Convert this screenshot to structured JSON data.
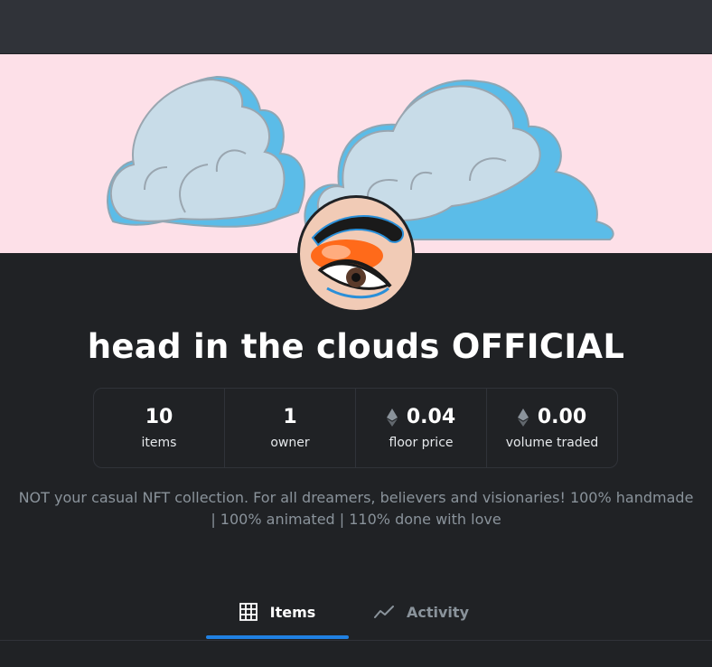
{
  "collection": {
    "title": "head in the clouds OFFICIAL",
    "description": "NOT your casual NFT collection. For all dreamers, believers and visionaries! 100% handmade | 100% animated | 110% done with love"
  },
  "stats": [
    {
      "value": "10",
      "label": "items",
      "eth": false
    },
    {
      "value": "1",
      "label": "owner",
      "eth": false
    },
    {
      "value": "0.04",
      "label": "floor price",
      "eth": true
    },
    {
      "value": "0.00",
      "label": "volume traded",
      "eth": true
    }
  ],
  "tabs": [
    {
      "label": "Items",
      "icon": "grid-icon",
      "active": true
    },
    {
      "label": "Activity",
      "icon": "activity-chart-icon",
      "active": false
    }
  ],
  "icons": {
    "stat_currency": "ethereum-icon"
  },
  "colors": {
    "background": "#202225",
    "topbar": "#303339",
    "banner": "#fde0e8",
    "accent": "#2081e2",
    "muted_text": "#8a939b"
  }
}
